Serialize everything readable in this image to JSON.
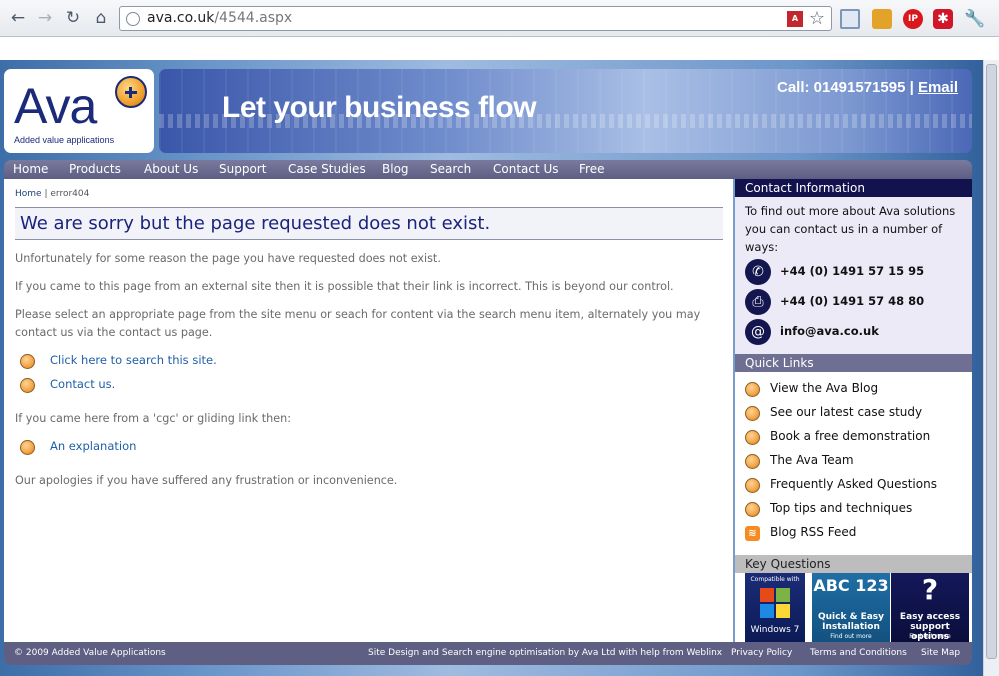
{
  "browser": {
    "url_host": "ava.co.uk",
    "url_path": "/4544.aspx"
  },
  "header": {
    "logo_text": "Ava",
    "logo_subtitle": "Added value applications",
    "tagline": "Let your business flow",
    "call_label": "Call: 01491571595",
    "separator": "|",
    "email_label": "Email"
  },
  "nav": {
    "items": [
      {
        "label": "Home"
      },
      {
        "label": "Products"
      },
      {
        "label": "About Us"
      },
      {
        "label": "Support"
      },
      {
        "label": "Case Studies"
      },
      {
        "label": "Blog"
      },
      {
        "label": "Search"
      },
      {
        "label": "Contact Us"
      },
      {
        "label": "Free"
      }
    ]
  },
  "main": {
    "breadcrumb_home": "Home",
    "breadcrumb_sep": "|",
    "breadcrumb_current": "error404",
    "title": "We are sorry but the page requested does not exist.",
    "para1": "Unfortunately for some reason the page you have requested does not exist.",
    "para2": "If you came to this page from an external site then it is possible that their link is incorrect. This is beyond our control.",
    "para3": "Please select an appropriate page from the site menu or seach for content via the search menu item, alternately you may contact us via the contact us page.",
    "link_search": "Click here to search this site.",
    "link_contact": "Contact us.",
    "para4": "If you came here from a 'cgc' or gliding link then:",
    "link_explanation": "An explanation",
    "para5": "Our apologies if you have suffered any frustration or inconvenience."
  },
  "sidebar": {
    "contact_heading": "Contact Information",
    "contact_intro": "To find out more about Ava solutions you can contact us in a number of ways:",
    "phone": "+44 (0) 1491 57 15 95",
    "fax": "+44 (0) 1491 57 48 80",
    "email": "info@ava.co.uk",
    "quick_heading": "Quick Links",
    "quick_links": [
      {
        "label": "View the Ava Blog"
      },
      {
        "label": "See our latest case study"
      },
      {
        "label": "Book a free demonstration"
      },
      {
        "label": "The Ava Team"
      },
      {
        "label": "Frequently Asked Questions"
      },
      {
        "label": "Top tips and techniques"
      },
      {
        "label": "Blog RSS Feed"
      }
    ],
    "key_heading": "Key Questions",
    "kq1_top": "Compatible with",
    "kq1_bottom": "Windows 7",
    "kq2_top": "ABC 123",
    "kq2_title": "Quick & Easy Installation",
    "kq2_more": "Find out more",
    "kq3_title": "Easy access support options",
    "kq3_more": "Find out more"
  },
  "footer": {
    "copyright": "© 2009 Added Value Applications",
    "credit": "Site Design and Search engine optimisation by Ava Ltd with help from Weblinx",
    "privacy": "Privacy Policy",
    "terms": "Terms and Conditions",
    "sitemap": "Site Map"
  }
}
